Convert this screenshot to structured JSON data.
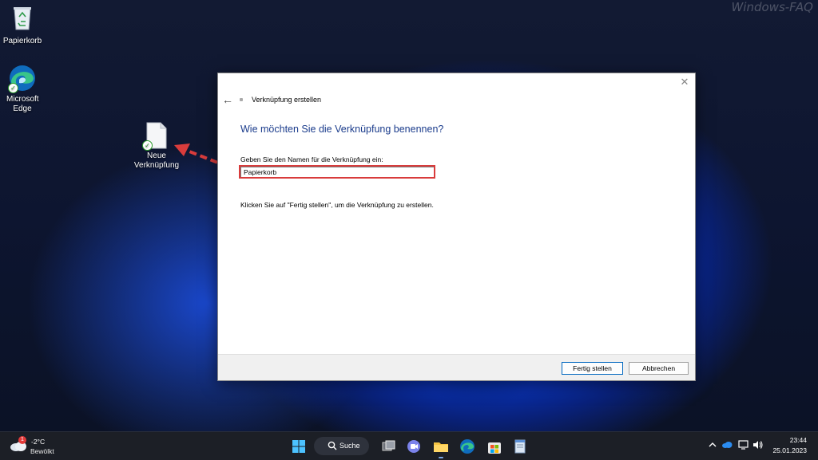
{
  "watermark": "Windows-FAQ",
  "desktop_icons": [
    {
      "label": "Papierkorb"
    },
    {
      "label": "Microsoft Edge"
    },
    {
      "label": "Neue Verknüpfung"
    }
  ],
  "dialog": {
    "title": "Verknüpfung erstellen",
    "heading": "Wie möchten Sie die Verknüpfung benennen?",
    "name_label": "Geben Sie den Namen für die Verknüpfung ein:",
    "name_value": "Papierkorb",
    "hint": "Klicken Sie auf \"Fertig stellen\", um die Verknüpfung zu erstellen.",
    "finish_label": "Fertig stellen",
    "cancel_label": "Abbrechen"
  },
  "taskbar": {
    "weather": {
      "badge": "1",
      "temp": "-2°C",
      "condition": "Bewölkt"
    },
    "search_label": "Suche",
    "time": "23:44",
    "date": "25.01.2023"
  },
  "colors": {
    "accent": "#0067c0",
    "heading": "#1b3c8c",
    "highlight": "#d93c3c",
    "taskbar": "#1c1f26"
  },
  "icons": {
    "recycle_bin": "recycle-bin-icon",
    "edge": "edge-icon",
    "shortcut": "file-shortcut-icon",
    "close": "close-icon",
    "back": "back-arrow-icon",
    "start": "windows-start-icon",
    "search": "search-icon",
    "task_view": "task-view-icon",
    "teams": "teams-chat-icon",
    "explorer": "file-explorer-icon",
    "store": "store-icon",
    "notepad": "notepad-icon",
    "chevron": "chevron-up-icon",
    "onedrive": "onedrive-icon",
    "network": "network-icon",
    "volume": "volume-icon"
  }
}
